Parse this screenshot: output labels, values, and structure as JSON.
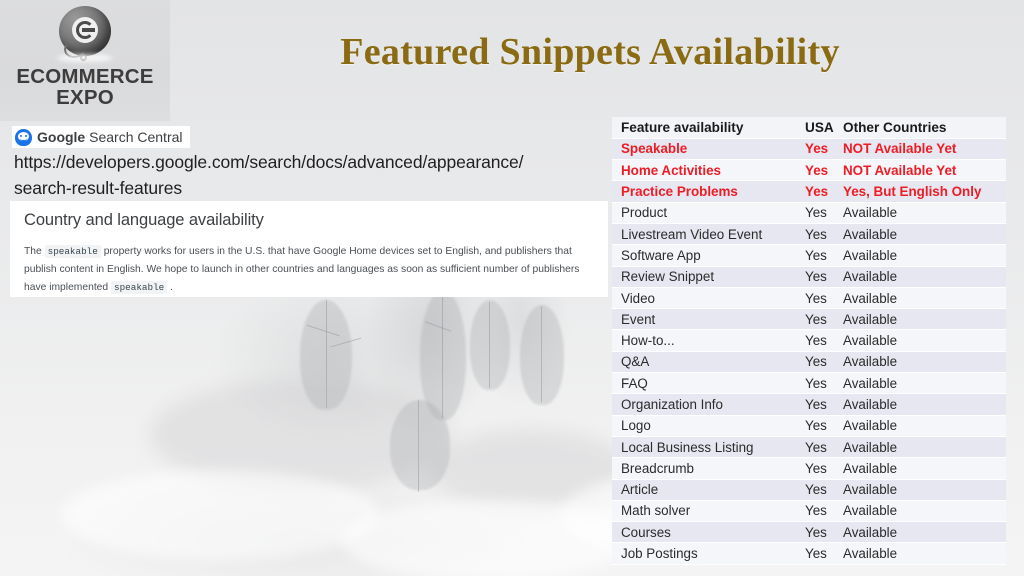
{
  "slide": {
    "title": "Featured Snippets Availability"
  },
  "logo": {
    "icon": "ecommerce-expo-sphere-logo",
    "line1": "ECOMMERCE",
    "line2": "EXPO"
  },
  "google_badge": {
    "icon": "google-robot-icon",
    "brand": "Google",
    "product": " Search Central"
  },
  "reference": {
    "url_line1": "https://developers.google.com/search/docs/advanced/appearance/",
    "url_line2": "search-result-features"
  },
  "doc_card": {
    "heading": "Country and language availability",
    "body_part1": "The ",
    "code1": "speakable",
    "body_part2": " property works for users in the U.S. that have Google Home devices set to English, and publishers that publish content in English. We hope to launch in other countries and languages as soon as sufficient number of publishers have implemented ",
    "code2": "speakable",
    "body_part3": " ."
  },
  "colors": {
    "title_gold": "#8a6a12",
    "highlight_red": "#ee1c25",
    "row_odd": "#e6e7f0",
    "row_even": "#f5f6fa",
    "header_bg": "#f3f4f8"
  },
  "table": {
    "headers": [
      "Feature availability",
      "USA",
      "Other Countries"
    ],
    "rows": [
      {
        "feature": "Speakable",
        "usa": "Yes",
        "other": "NOT Available Yet",
        "highlight": true
      },
      {
        "feature": "Home Activities",
        "usa": "Yes",
        "other": "NOT Available Yet",
        "highlight": true
      },
      {
        "feature": "Practice Problems",
        "usa": "Yes",
        "other": "Yes, But English Only",
        "highlight": true
      },
      {
        "feature": "Product",
        "usa": "Yes",
        "other": "Available",
        "highlight": false
      },
      {
        "feature": "Livestream Video Event",
        "usa": "Yes",
        "other": "Available",
        "highlight": false
      },
      {
        "feature": "Software App",
        "usa": "Yes",
        "other": "Available",
        "highlight": false
      },
      {
        "feature": "Review Snippet",
        "usa": "Yes",
        "other": "Available",
        "highlight": false
      },
      {
        "feature": "Video",
        "usa": "Yes",
        "other": "Available",
        "highlight": false
      },
      {
        "feature": "Event",
        "usa": "Yes",
        "other": "Available",
        "highlight": false
      },
      {
        "feature": "How-to...",
        "usa": "Yes",
        "other": "Available",
        "highlight": false
      },
      {
        "feature": "Q&A",
        "usa": "Yes",
        "other": "Available",
        "highlight": false
      },
      {
        "feature": "FAQ",
        "usa": "Yes",
        "other": "Available",
        "highlight": false
      },
      {
        "feature": "Organization Info",
        "usa": "Yes",
        "other": "Available",
        "highlight": false
      },
      {
        "feature": "Logo",
        "usa": "Yes",
        "other": "Available",
        "highlight": false
      },
      {
        "feature": "Local Business Listing",
        "usa": "Yes",
        "other": "Available",
        "highlight": false
      },
      {
        "feature": "Breadcrumb",
        "usa": "Yes",
        "other": "Available",
        "highlight": false
      },
      {
        "feature": "Article",
        "usa": "Yes",
        "other": "Available",
        "highlight": false
      },
      {
        "feature": "Math solver",
        "usa": "Yes",
        "other": "Available",
        "highlight": false
      },
      {
        "feature": "Courses",
        "usa": "Yes",
        "other": "Available",
        "highlight": false
      },
      {
        "feature": "Job Postings",
        "usa": "Yes",
        "other": "Available",
        "highlight": false
      }
    ]
  }
}
